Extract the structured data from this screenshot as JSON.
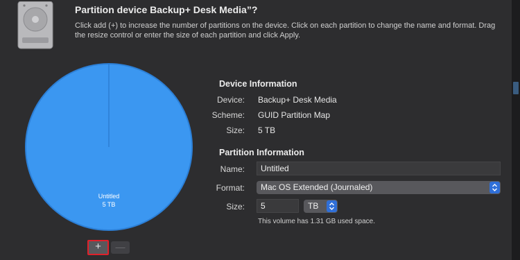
{
  "dialog": {
    "title": "Partition device Backup+ Desk Media”?",
    "description": "Click add (+) to increase the number of partitions on the device. Click on each partition to change the name and format. Drag the resize control or enter the size of each partition and click Apply."
  },
  "pie": {
    "partition_name": "Untitled",
    "partition_size": "5 TB",
    "color": "#3b97f1"
  },
  "buttons": {
    "add": "+",
    "remove": "—"
  },
  "device_info": {
    "heading": "Device Information",
    "device_label": "Device:",
    "device_value": "Backup+ Desk Media",
    "scheme_label": "Scheme:",
    "scheme_value": "GUID Partition Map",
    "size_label": "Size:",
    "size_value": "5 TB"
  },
  "partition_info": {
    "heading": "Partition Information",
    "name_label": "Name:",
    "name_value": "Untitled",
    "format_label": "Format:",
    "format_value": "Mac OS Extended (Journaled)",
    "size_label": "Size:",
    "size_value": "5",
    "size_unit": "TB",
    "note": "This volume has 1.31 GB used space."
  },
  "colors": {
    "accent": "#2f6fd8",
    "highlight": "#e0202a"
  }
}
